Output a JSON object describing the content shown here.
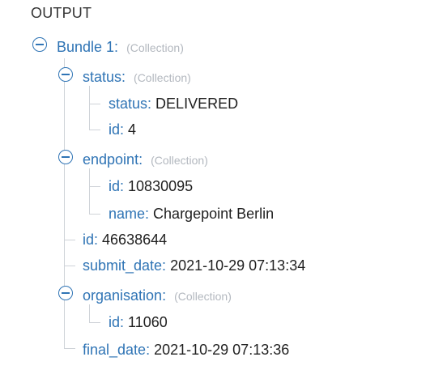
{
  "panel": {
    "title": "OUTPUT"
  },
  "tree": {
    "root": {
      "key": "Bundle 1:",
      "type": "(Collection)"
    },
    "status": {
      "key": "status:",
      "type": "(Collection)",
      "children": [
        {
          "key": "status:",
          "value": "DELIVERED"
        },
        {
          "key": "id:",
          "value": "4"
        }
      ]
    },
    "endpoint": {
      "key": "endpoint:",
      "type": "(Collection)",
      "children": [
        {
          "key": "id:",
          "value": "10830095"
        },
        {
          "key": "name:",
          "value": "Chargepoint Berlin"
        }
      ]
    },
    "id": {
      "key": "id:",
      "value": "46638644"
    },
    "submit_date": {
      "key": "submit_date:",
      "value": "2021-10-29 07:13:34"
    },
    "organisation": {
      "key": "organisation:",
      "type": "(Collection)",
      "children": [
        {
          "key": "id:",
          "value": "11060"
        }
      ]
    },
    "final_date": {
      "key": "final_date:",
      "value": "2021-10-29 07:13:36"
    }
  },
  "colors": {
    "key": "#2f74b5",
    "value": "#1f1f1f",
    "type_hint": "#b3b8bf",
    "tree_line": "#cfd3d8"
  },
  "icons": {
    "toggle": "collapse-circle-minus-icon"
  }
}
